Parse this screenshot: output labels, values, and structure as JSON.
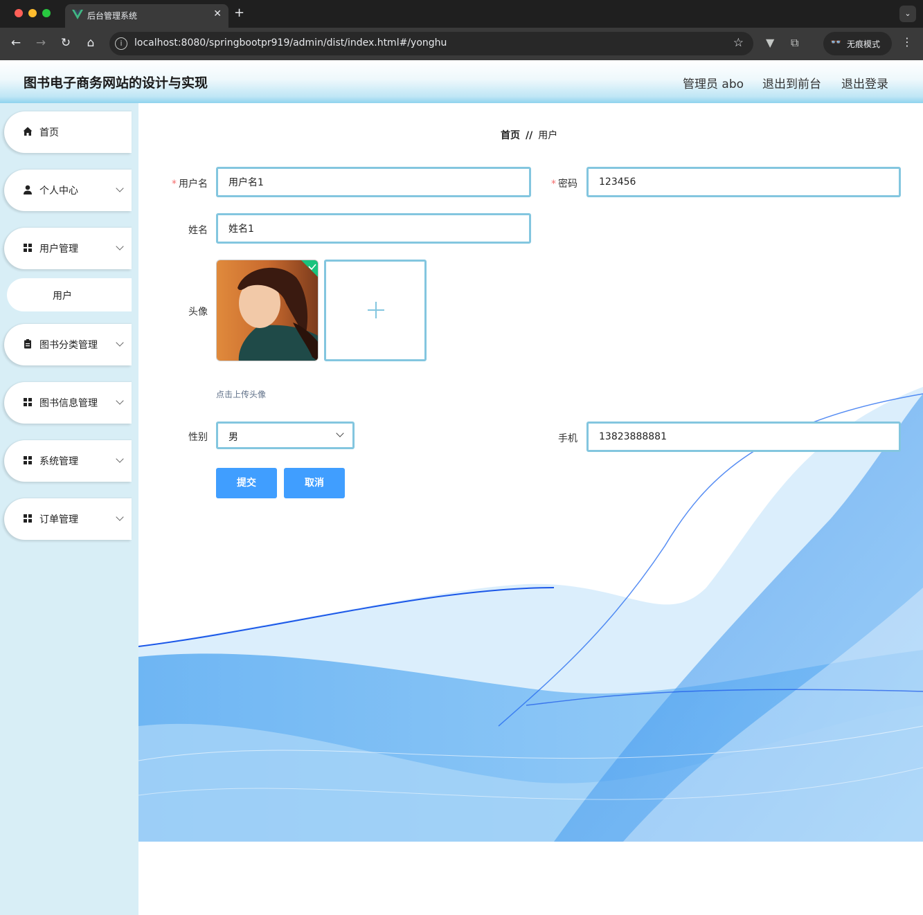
{
  "browser": {
    "tab_title": "后台管理系统",
    "tab_close": "✕",
    "new_tab": "+",
    "url": "localhost:8080/springbootpr919/admin/dist/index.html#/yonghu",
    "incognito_label": "无痕模式"
  },
  "header": {
    "title": "图书电子商务网站的设计与实现",
    "user_label": "管理员 abo",
    "to_front_label": "退出到前台",
    "logout_label": "退出登录"
  },
  "sidebar": {
    "items": [
      {
        "label": "首页",
        "icon": "home-icon",
        "has_arrow": false
      },
      {
        "label": "个人中心",
        "icon": "user-icon",
        "has_arrow": true
      },
      {
        "label": "用户管理",
        "icon": "grid-icon",
        "has_arrow": true
      },
      {
        "label": "图书分类管理",
        "icon": "clipboard-icon",
        "has_arrow": true
      },
      {
        "label": "图书信息管理",
        "icon": "grid-icon",
        "has_arrow": true
      },
      {
        "label": "系统管理",
        "icon": "grid-icon",
        "has_arrow": true
      },
      {
        "label": "订单管理",
        "icon": "grid-icon",
        "has_arrow": true
      }
    ],
    "sub_item": {
      "label": "用户"
    }
  },
  "breadcrumb": {
    "home": "首页",
    "separator": "//",
    "current": "用户"
  },
  "form": {
    "username": {
      "label": "用户名",
      "value": "用户名1",
      "required": "*"
    },
    "password": {
      "label": "密码",
      "value": "123456",
      "required": "*"
    },
    "name": {
      "label": "姓名",
      "value": "姓名1"
    },
    "avatar": {
      "label": "头像",
      "hint": "点击上传头像"
    },
    "gender": {
      "label": "性别",
      "value": "男"
    },
    "phone": {
      "label": "手机",
      "value": "13823888881"
    },
    "submit_label": "提交",
    "cancel_label": "取消"
  },
  "colors": {
    "accent": "#409eff",
    "input_border": "#83c6df",
    "sidebar_bg": "#d8eef6",
    "required": "#f56c6c"
  }
}
